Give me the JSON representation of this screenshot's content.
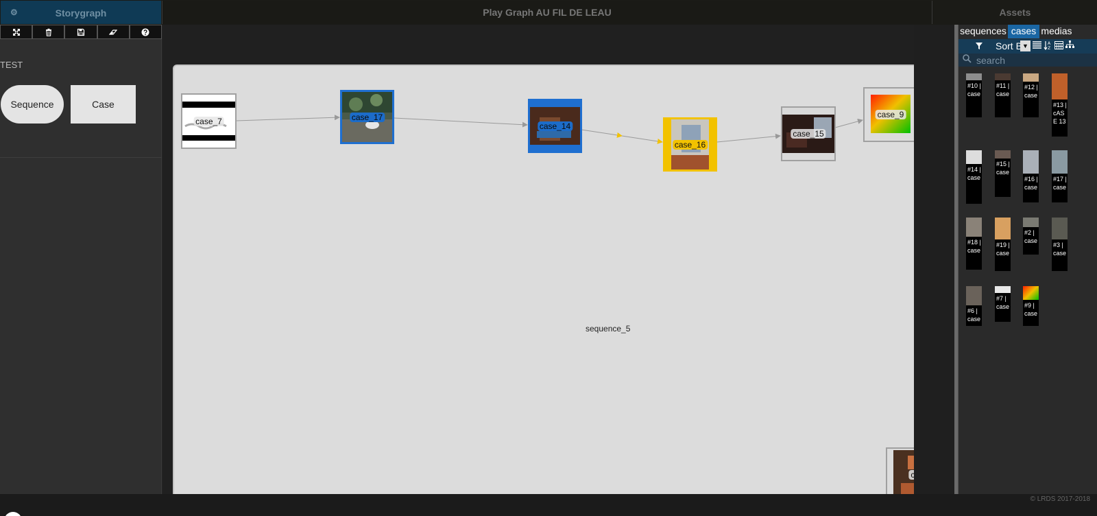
{
  "header": {
    "left_title": "Storygraph",
    "center_title": "Play Graph AU FIL DE LEAU",
    "right_title": "Assets"
  },
  "left": {
    "project_name": "TEST",
    "shapes": {
      "sequence": "Sequence",
      "case": "Case"
    }
  },
  "graph": {
    "sequence_label": "sequence_5",
    "nodes": [
      {
        "id": "n7",
        "label": "case_7"
      },
      {
        "id": "n17",
        "label": "case_17"
      },
      {
        "id": "n14",
        "label": "case_14"
      },
      {
        "id": "n16",
        "label": "case_16"
      },
      {
        "id": "n15",
        "label": "case_15"
      },
      {
        "id": "n9",
        "label": "case_9"
      },
      {
        "id": "nb",
        "label": "case"
      }
    ]
  },
  "assets": {
    "tabs": [
      "sequences",
      "cases",
      "medias"
    ],
    "active_tab": "cases",
    "sort_label": "Sort B",
    "search_placeholder": "search",
    "cards": [
      {
        "text": "#10 | case"
      },
      {
        "text": "#11 | case"
      },
      {
        "text": "#12 | case"
      },
      {
        "text": "#13 | cASE 13"
      },
      {
        "text": "#14 | case"
      },
      {
        "text": "#15 | case"
      },
      {
        "text": "#16 | case"
      },
      {
        "text": "#17 | case"
      },
      {
        "text": "#18 | case"
      },
      {
        "text": "#19 | case"
      },
      {
        "text": "#2 | case"
      },
      {
        "text": "#3 | case"
      },
      {
        "text": "#6 | case"
      },
      {
        "text": "#7 | case"
      },
      {
        "text": "#9 | case"
      }
    ]
  },
  "footer": {
    "copyright": "©  LRDS 2017-2018"
  },
  "colors": {
    "accent_blue": "#1a66a3",
    "selected_blue": "#1c6cc9",
    "selected_yellow": "#f2c200",
    "header_blue": "#0f3a55"
  }
}
